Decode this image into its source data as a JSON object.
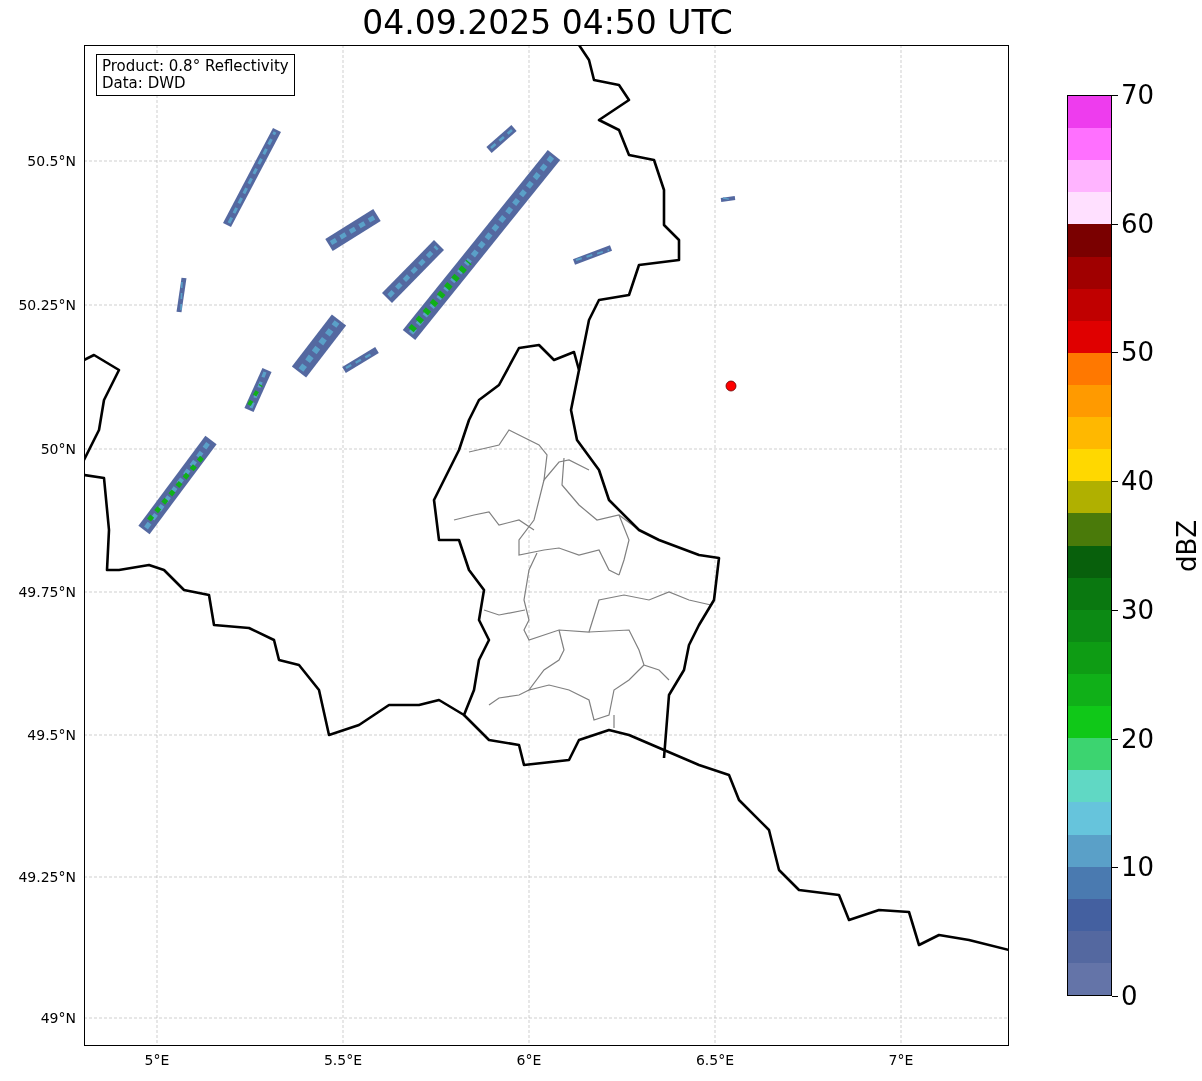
{
  "title": "04.09.2025 04:50 UTC",
  "info_box": {
    "lines": [
      "Product: 0.8° Reflectivity",
      "Data: DWD"
    ]
  },
  "map": {
    "lat_labels": [
      "50.5°N",
      "50.25°N",
      "50°N",
      "49.75°N",
      "49.5°N",
      "49.25°N",
      "49°N"
    ],
    "lon_labels": [
      "5°E",
      "5.5°E",
      "6°E",
      "6.5°E",
      "7°E"
    ]
  },
  "colorbar": {
    "label": "dBZ",
    "ticks": [
      "70",
      "60",
      "50",
      "40",
      "30",
      "20",
      "10",
      "0"
    ],
    "bands": [
      {
        "color": "#ee3cee"
      },
      {
        "color": "#ff70ff"
      },
      {
        "color": "#ffb4ff"
      },
      {
        "color": "#ffe0ff"
      },
      {
        "color": "#7a0000"
      },
      {
        "color": "#a00000"
      },
      {
        "color": "#c00000"
      },
      {
        "color": "#e00000"
      },
      {
        "color": "#ff7800"
      },
      {
        "color": "#ff9a00"
      },
      {
        "color": "#ffb800"
      },
      {
        "color": "#ffd800"
      },
      {
        "color": "#b0b000"
      },
      {
        "color": "#4a7a0a"
      },
      {
        "color": "#08600c"
      },
      {
        "color": "#0a7810"
      },
      {
        "color": "#0c8a14"
      },
      {
        "color": "#0e9c14"
      },
      {
        "color": "#10b018"
      },
      {
        "color": "#10c818"
      },
      {
        "color": "#3cd470"
      },
      {
        "color": "#60d8c4"
      },
      {
        "color": "#66c4dc"
      },
      {
        "color": "#5aa0c8"
      },
      {
        "color": "#4a7ab0"
      },
      {
        "color": "#4460a0"
      },
      {
        "color": "#5468a0"
      },
      {
        "color": "#6474a8"
      }
    ]
  }
}
